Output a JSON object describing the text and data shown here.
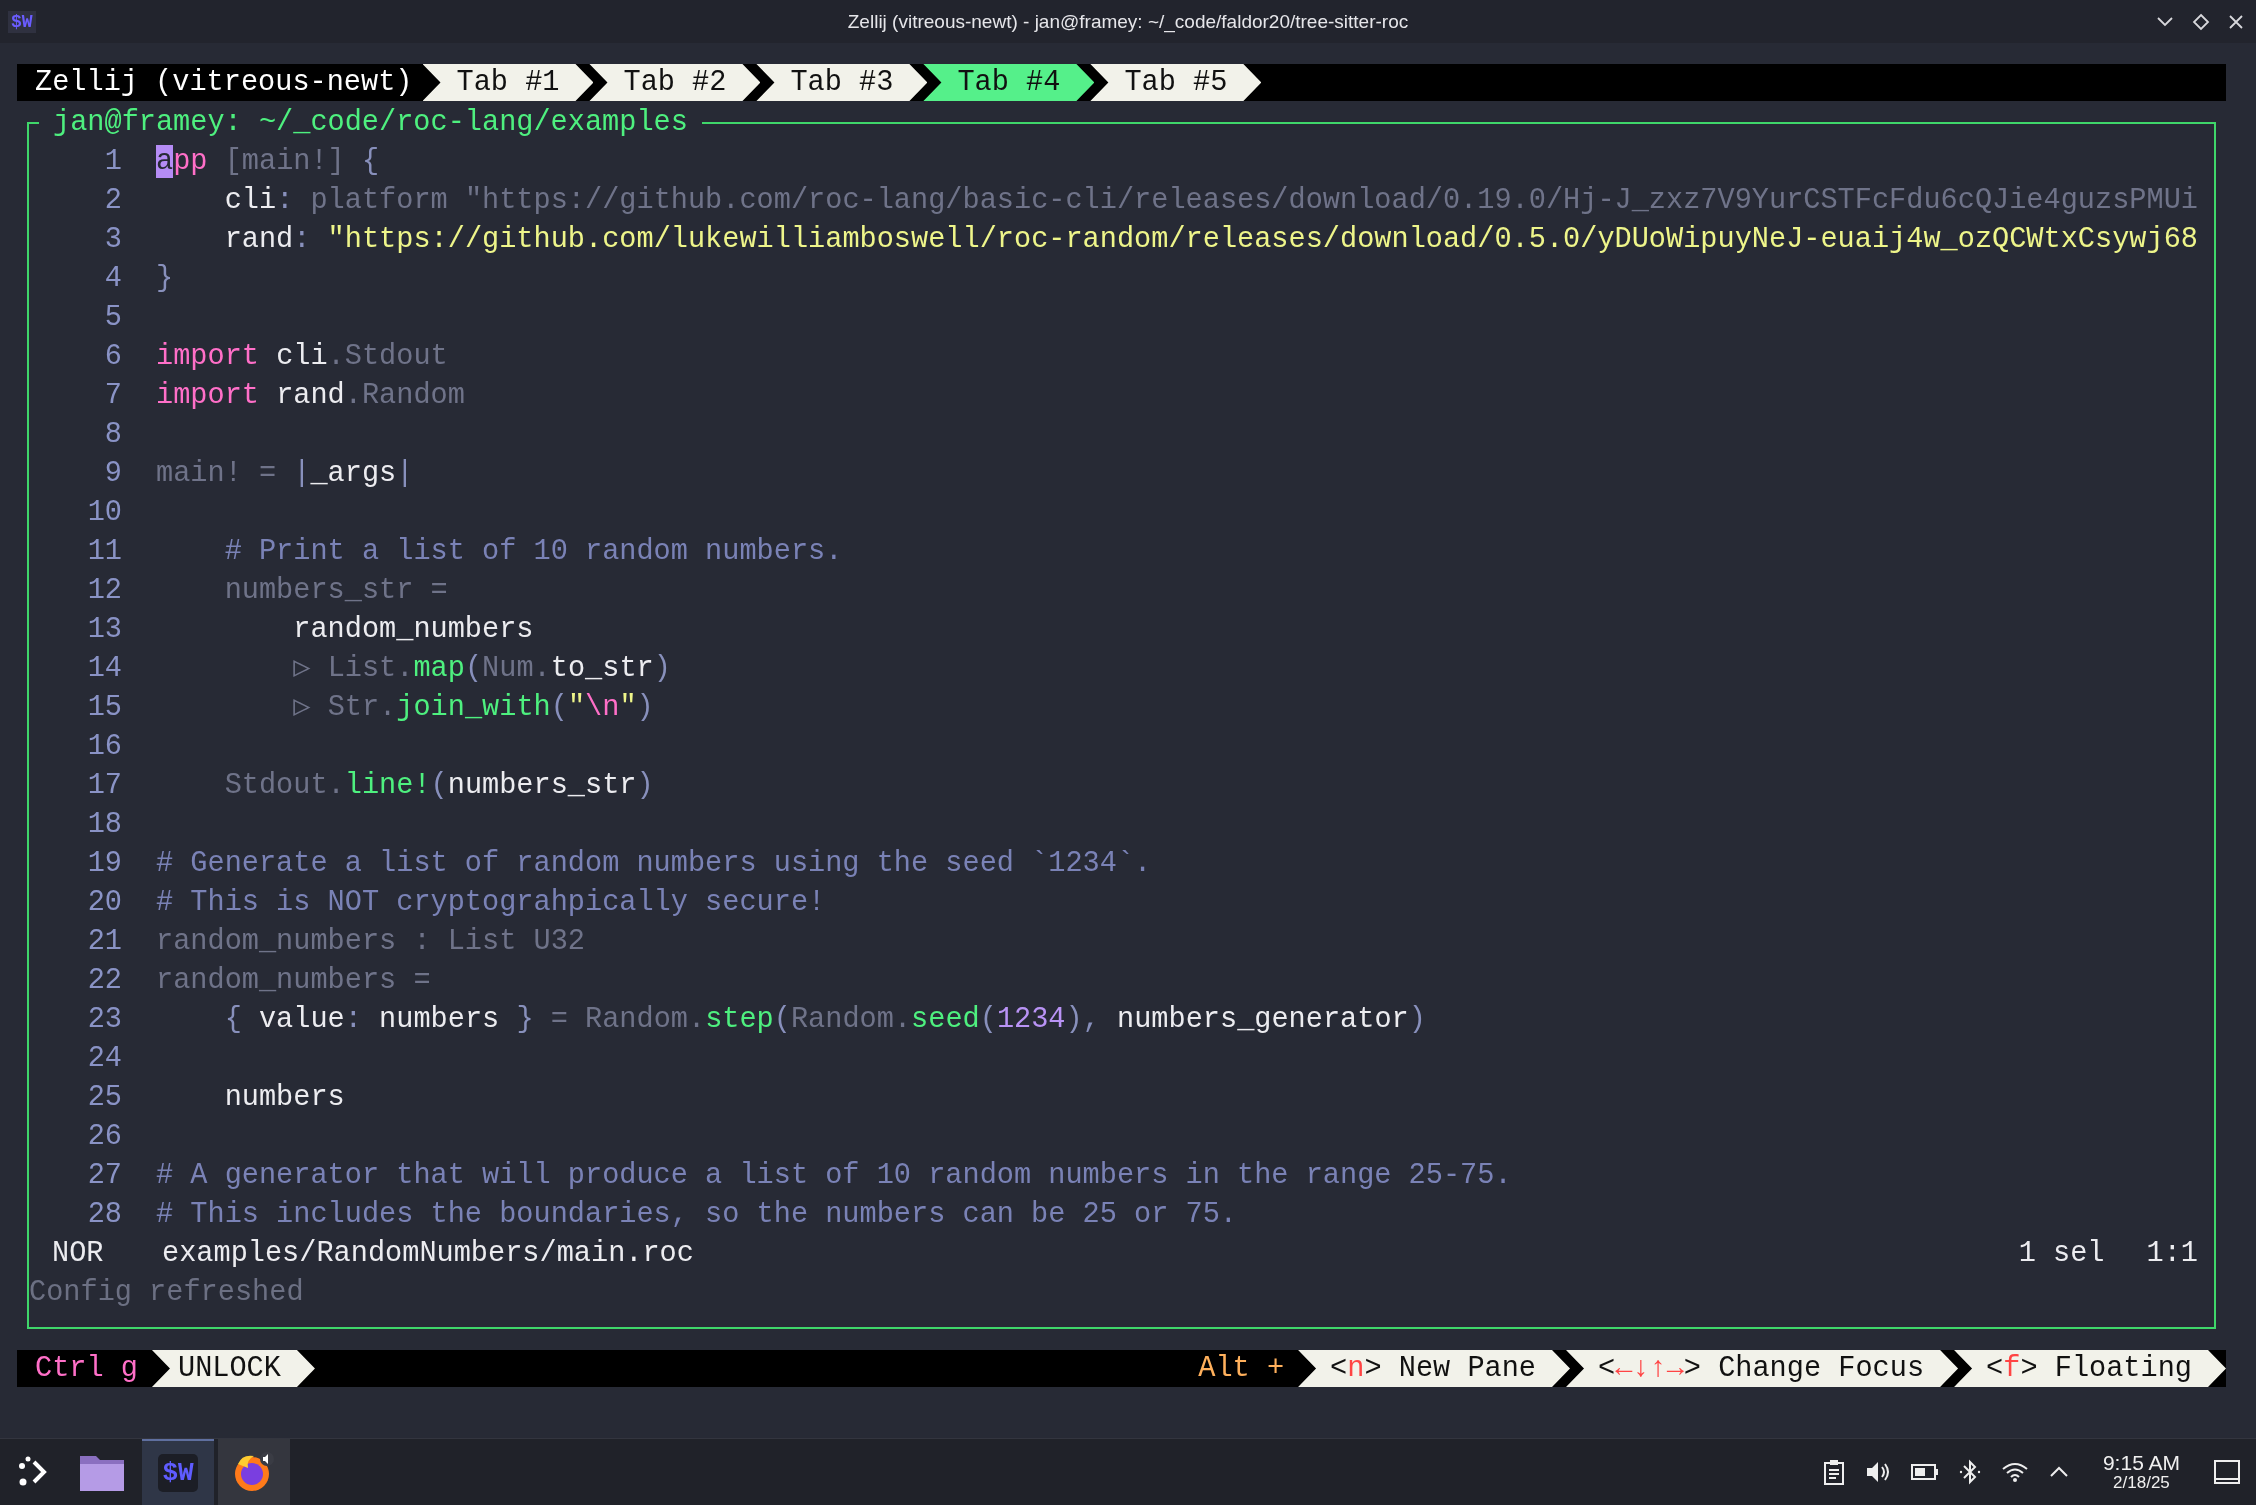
{
  "window": {
    "icon_text": "$W",
    "title": "Zellij (vitreous-newt) - jan@framey: ~/_code/faldor20/tree-sitter-roc"
  },
  "tab_bar": {
    "session": "Zellij (vitreous-newt)",
    "tabs": [
      {
        "label": "Tab #1",
        "selected": false
      },
      {
        "label": "Tab #2",
        "selected": false
      },
      {
        "label": "Tab #3",
        "selected": false
      },
      {
        "label": "Tab #4",
        "selected": true
      },
      {
        "label": "Tab #5",
        "selected": false
      }
    ]
  },
  "pane": {
    "title": "jan@framey: ~/_code/roc-lang/examples",
    "lines": [
      {
        "number": "1",
        "tokens": [
          {
            "kind": "cursor",
            "text": "a"
          },
          {
            "kind": "keyword",
            "text": "pp"
          },
          {
            "kind": "dim",
            "text": " [main!] "
          },
          {
            "kind": "punct",
            "text": "{"
          }
        ]
      },
      {
        "number": "2",
        "tokens": [
          {
            "kind": "plain",
            "text": "    cli"
          },
          {
            "kind": "punct",
            "text": ":"
          },
          {
            "kind": "dim",
            "text": " platform \"https://github.com/roc-lang/basic-cli/releases/download/0.19.0/Hj-J_zxz7V9YurCSTFcFdu6cQJie4guzsPMUi"
          }
        ]
      },
      {
        "number": "3",
        "tokens": [
          {
            "kind": "plain",
            "text": "    rand"
          },
          {
            "kind": "punct",
            "text": ": "
          },
          {
            "kind": "string",
            "text": "\"https://github.com/lukewilliamboswell/roc-random/releases/download/0.5.0/yDUoWipuyNeJ-euaij4w_ozQCWtxCsywj68"
          }
        ]
      },
      {
        "number": "4",
        "tokens": [
          {
            "kind": "punct",
            "text": "}"
          }
        ]
      },
      {
        "number": "5"
      },
      {
        "number": "6",
        "tokens": [
          {
            "kind": "keyword",
            "text": "import"
          },
          {
            "kind": "plain",
            "text": " cli"
          },
          {
            "kind": "dim",
            "text": ".Stdout"
          }
        ]
      },
      {
        "number": "7",
        "tokens": [
          {
            "kind": "keyword",
            "text": "import"
          },
          {
            "kind": "plain",
            "text": " rand"
          },
          {
            "kind": "dim",
            "text": ".Random"
          }
        ]
      },
      {
        "number": "8"
      },
      {
        "number": "9",
        "tokens": [
          {
            "kind": "dim",
            "text": "main! = "
          },
          {
            "kind": "punct",
            "text": "|"
          },
          {
            "kind": "plain",
            "text": "_args"
          },
          {
            "kind": "punct",
            "text": "|"
          }
        ]
      },
      {
        "number": "10"
      },
      {
        "number": "11",
        "tokens": [
          {
            "kind": "comment",
            "text": "    # Print a list of 10 random numbers."
          }
        ]
      },
      {
        "number": "12",
        "tokens": [
          {
            "kind": "dim",
            "text": "    numbers_str ="
          }
        ]
      },
      {
        "number": "13",
        "tokens": [
          {
            "kind": "plain",
            "text": "        random_numbers"
          }
        ]
      },
      {
        "number": "14",
        "tokens": [
          {
            "kind": "dim",
            "text": "        ▷ List."
          },
          {
            "kind": "func",
            "text": "map"
          },
          {
            "kind": "punct",
            "text": "("
          },
          {
            "kind": "dim",
            "text": "Num."
          },
          {
            "kind": "plain",
            "text": "to_str"
          },
          {
            "kind": "punct",
            "text": ")"
          }
        ]
      },
      {
        "number": "15",
        "tokens": [
          {
            "kind": "dim",
            "text": "        ▷ Str."
          },
          {
            "kind": "func",
            "text": "join_with"
          },
          {
            "kind": "punct",
            "text": "("
          },
          {
            "kind": "string",
            "text": "\""
          },
          {
            "kind": "escape",
            "text": "\\n"
          },
          {
            "kind": "string",
            "text": "\""
          },
          {
            "kind": "punct",
            "text": ")"
          }
        ]
      },
      {
        "number": "16"
      },
      {
        "number": "17",
        "tokens": [
          {
            "kind": "dim",
            "text": "    Stdout."
          },
          {
            "kind": "func",
            "text": "line!"
          },
          {
            "kind": "punct",
            "text": "("
          },
          {
            "kind": "plain",
            "text": "numbers_str"
          },
          {
            "kind": "punct",
            "text": ")"
          }
        ]
      },
      {
        "number": "18"
      },
      {
        "number": "19",
        "tokens": [
          {
            "kind": "comment",
            "text": "# Generate a list of random numbers using the seed `1234`."
          }
        ]
      },
      {
        "number": "20",
        "tokens": [
          {
            "kind": "comment",
            "text": "# This is NOT cryptograhpically secure!"
          }
        ]
      },
      {
        "number": "21",
        "tokens": [
          {
            "kind": "dim",
            "text": "random_numbers : List U32"
          }
        ]
      },
      {
        "number": "22",
        "tokens": [
          {
            "kind": "dim",
            "text": "random_numbers ="
          }
        ]
      },
      {
        "number": "23",
        "tokens": [
          {
            "kind": "punct",
            "text": "    {"
          },
          {
            "kind": "plain",
            "text": " value"
          },
          {
            "kind": "punct",
            "text": ":"
          },
          {
            "kind": "plain",
            "text": " numbers "
          },
          {
            "kind": "punct",
            "text": "}"
          },
          {
            "kind": "dim",
            "text": " = Random."
          },
          {
            "kind": "func",
            "text": "step"
          },
          {
            "kind": "punct",
            "text": "("
          },
          {
            "kind": "dim",
            "text": "Random."
          },
          {
            "kind": "func",
            "text": "seed"
          },
          {
            "kind": "punct",
            "text": "("
          },
          {
            "kind": "number",
            "text": "1234"
          },
          {
            "kind": "punct",
            "text": "), "
          },
          {
            "kind": "plain",
            "text": "numbers_generator"
          },
          {
            "kind": "punct",
            "text": ")"
          }
        ]
      },
      {
        "number": "24"
      },
      {
        "number": "25",
        "tokens": [
          {
            "kind": "plain",
            "text": "    numbers"
          }
        ]
      },
      {
        "number": "26"
      },
      {
        "number": "27",
        "tokens": [
          {
            "kind": "comment",
            "text": "# A generator that will produce a list of 10 random numbers in the range 25-75."
          }
        ]
      },
      {
        "number": "28",
        "tokens": [
          {
            "kind": "comment",
            "text": "# This includes the boundaries, so the numbers can be 25 or 75."
          }
        ]
      }
    ],
    "status_line": {
      "mode": "NOR",
      "file": "examples/RandomNumbers/main.roc",
      "selection": "1 sel",
      "position": "1:1"
    },
    "message": "Config refreshed"
  },
  "bottom_bar": {
    "shortcut": "Ctrl g",
    "lock_label": "UNLOCK",
    "modifier": "Alt +",
    "hints": [
      {
        "open": "<",
        "key": "n",
        "close": ">",
        "label": "New Pane"
      },
      {
        "open": "<",
        "key": "←↓↑→",
        "close": ">",
        "label": "Change Focus"
      },
      {
        "open": "<",
        "key": "f",
        "close": ">",
        "label": "Floating"
      }
    ]
  },
  "taskbar": {
    "apps": [
      {
        "kind": "folder",
        "selected": false,
        "running": false
      },
      {
        "kind": "terminal",
        "label": "$W",
        "selected": true,
        "running": true
      },
      {
        "kind": "browser",
        "selected": false,
        "running": true
      }
    ],
    "clock": {
      "time": "9:15 AM",
      "date": "2/18/25"
    }
  }
}
